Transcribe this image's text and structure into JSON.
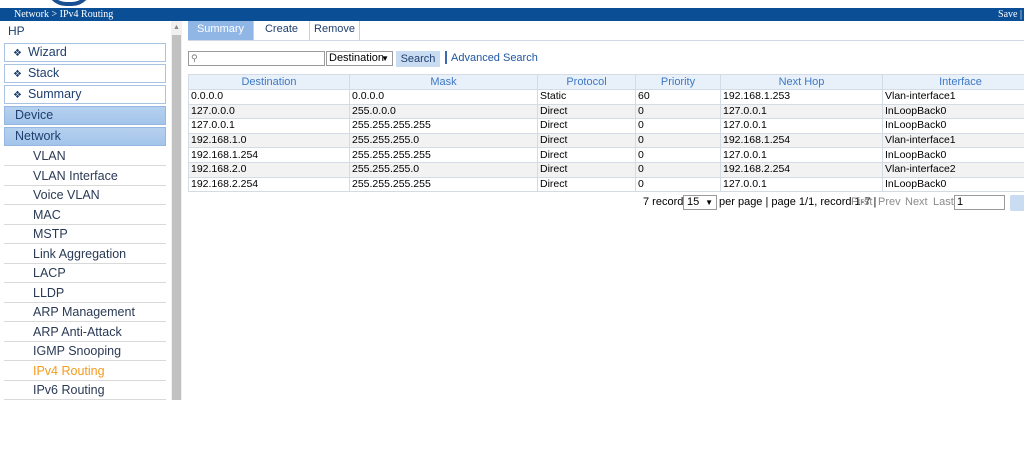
{
  "status_bar": {
    "breadcrumb": "Network > IPv4 Routing",
    "save": "Save |"
  },
  "sidebar": {
    "brand": "HP",
    "boxes": [
      {
        "label": "Wizard",
        "icon": "pin-icon"
      },
      {
        "label": "Stack",
        "icon": "pin-icon"
      },
      {
        "label": "Summary",
        "icon": "pin-icon"
      }
    ],
    "sections": [
      "Device",
      "Network"
    ],
    "items": [
      "VLAN",
      "VLAN Interface",
      "Voice VLAN",
      "MAC",
      "MSTP",
      "Link Aggregation",
      "LACP",
      "LLDP",
      "ARP Management",
      "ARP Anti-Attack",
      "IGMP Snooping",
      "IPv4 Routing",
      "IPv6 Routing"
    ],
    "active_item": "IPv4 Routing"
  },
  "tabs": [
    "Summary",
    "Create",
    "Remove"
  ],
  "active_tab": "Summary",
  "search": {
    "value": "",
    "field": "Destination",
    "button": "Search",
    "advanced": "Advanced Search"
  },
  "table": {
    "columns": [
      "Destination",
      "Mask",
      "Protocol",
      "Priority",
      "Next Hop",
      "Interface"
    ],
    "rows": [
      [
        "0.0.0.0",
        "0.0.0.0",
        "Static",
        "60",
        "192.168.1.253",
        "Vlan-interface1"
      ],
      [
        "127.0.0.0",
        "255.0.0.0",
        "Direct",
        "0",
        "127.0.0.1",
        "InLoopBack0"
      ],
      [
        "127.0.0.1",
        "255.255.255.255",
        "Direct",
        "0",
        "127.0.0.1",
        "InLoopBack0"
      ],
      [
        "192.168.1.0",
        "255.255.255.0",
        "Direct",
        "0",
        "192.168.1.254",
        "Vlan-interface1"
      ],
      [
        "192.168.1.254",
        "255.255.255.255",
        "Direct",
        "0",
        "127.0.0.1",
        "InLoopBack0"
      ],
      [
        "192.168.2.0",
        "255.255.255.0",
        "Direct",
        "0",
        "192.168.2.254",
        "Vlan-interface2"
      ],
      [
        "192.168.2.254",
        "255.255.255.255",
        "Direct",
        "0",
        "127.0.0.1",
        "InLoopBack0"
      ]
    ]
  },
  "pager": {
    "records": "7 records,",
    "page_size": "15",
    "per_page_text": "per page | page 1/1, record 1-7 |",
    "first": "First",
    "prev": "Prev",
    "next": "Next",
    "last": "Last",
    "page_value": "1"
  },
  "colors": {
    "status_bar": "#0a4e96",
    "active_tab": "#8fb6e4",
    "active_menu_item": "#f49b1f",
    "header_text": "#3d78c6"
  }
}
